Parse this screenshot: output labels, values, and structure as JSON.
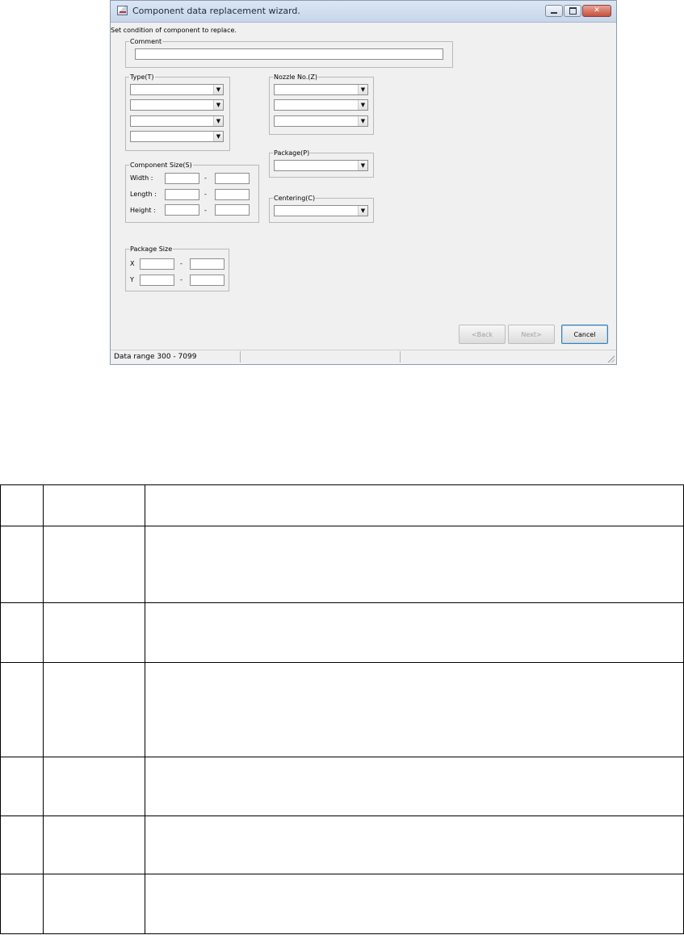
{
  "window": {
    "title": "Component data replacement wizard."
  },
  "instruction": "Set condition of component to replace.",
  "comment": {
    "legend": "Comment",
    "value": ""
  },
  "type": {
    "legend": "Type(T)",
    "combos": [
      "",
      "",
      "",
      ""
    ]
  },
  "nozzle": {
    "legend": "Nozzle No.(Z)",
    "combos": [
      "",
      "",
      ""
    ]
  },
  "component_size": {
    "legend": "Component Size(S)",
    "rows": [
      {
        "label": "Width :",
        "sep": "-",
        "min": "",
        "max": ""
      },
      {
        "label": "Length :",
        "sep": "-",
        "min": "",
        "max": ""
      },
      {
        "label": "Height :",
        "sep": "-",
        "min": "",
        "max": ""
      }
    ]
  },
  "package": {
    "legend": "Package(P)",
    "value": ""
  },
  "centering": {
    "legend": "Centering(C)",
    "value": ""
  },
  "package_size": {
    "legend": "Package Size",
    "rows": [
      {
        "label": "X",
        "sep": "-",
        "min": "",
        "max": ""
      },
      {
        "label": "Y",
        "sep": "-",
        "min": "",
        "max": ""
      }
    ]
  },
  "buttons": {
    "back": "<Back",
    "next": "Next>",
    "cancel": "Cancel"
  },
  "status": {
    "panels": [
      "Data range  300 - 7099",
      "",
      ""
    ]
  },
  "table": {
    "rows": [
      [
        "",
        "",
        ""
      ],
      [
        "",
        "",
        ""
      ],
      [
        "",
        "",
        ""
      ],
      [
        "",
        "",
        ""
      ],
      [
        "",
        "",
        ""
      ],
      [
        "",
        "",
        ""
      ],
      [
        "",
        "",
        ""
      ]
    ]
  },
  "colors": {
    "window_bg": "#f0f0f0",
    "title_gradient_top": "#dbe6f4",
    "close_red": "#c5503c"
  },
  "icons": [
    "app-icon",
    "minimize-icon",
    "maximize-icon",
    "close-icon",
    "dropdown-arrow-icon",
    "resize-grip-icon"
  ]
}
